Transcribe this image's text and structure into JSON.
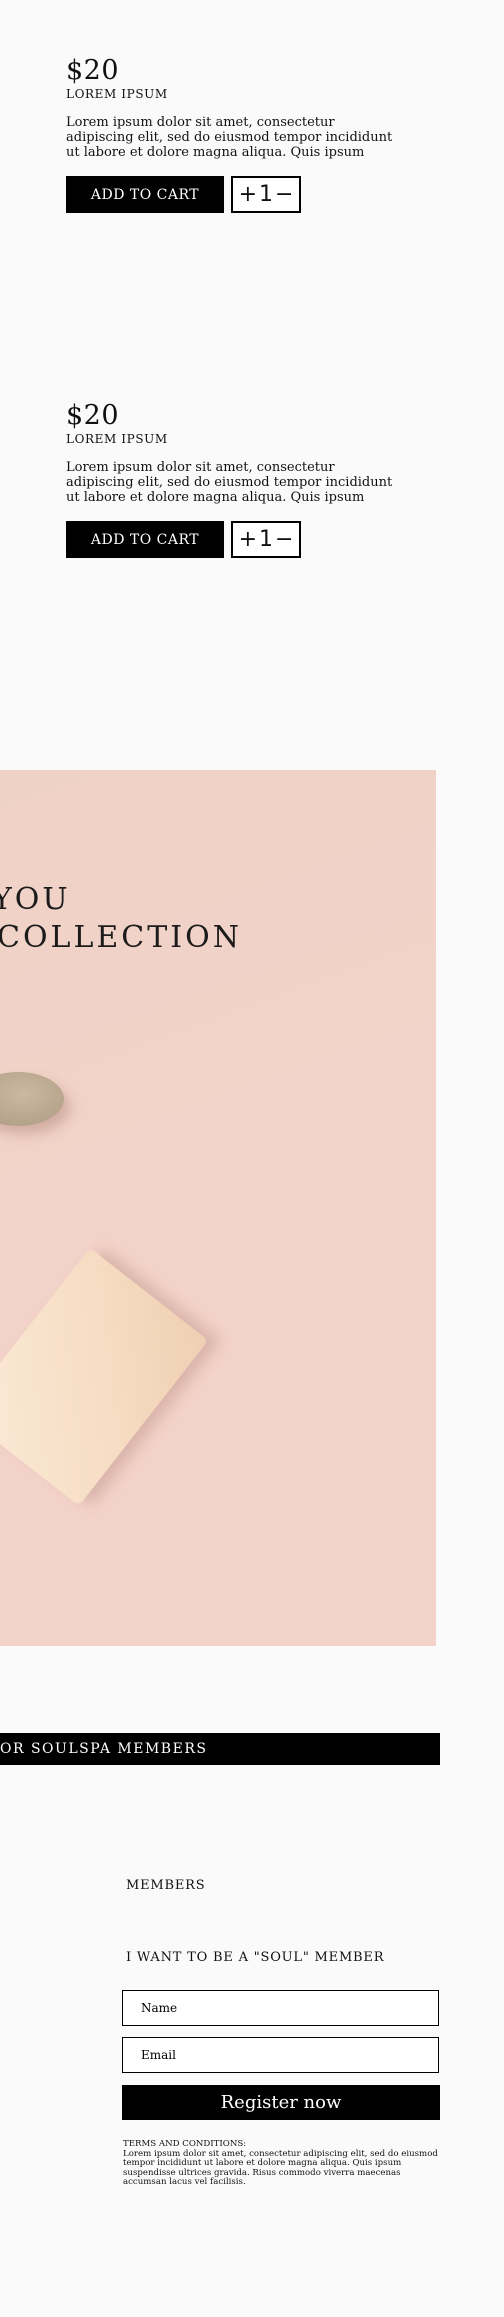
{
  "products": [
    {
      "price": "$20",
      "name": "LOREM IPSUM",
      "description": "Lorem ipsum dolor sit amet, consectetur adipiscing elit, sed do eiusmod tempor incididunt ut labore et dolore magna aliqua. Quis ipsum",
      "add_to_cart_label": "ADD TO CART",
      "stepper": {
        "plus": "+",
        "quantity": "1",
        "minus": "−"
      }
    },
    {
      "price": "$20",
      "name": "LOREM IPSUM",
      "description": "Lorem ipsum dolor sit amet, consectetur adipiscing elit, sed do eiusmod tempor incididunt ut labore et dolore magna aliqua. Quis ipsum",
      "add_to_cart_label": "ADD TO CART",
      "stepper": {
        "plus": "+",
        "quantity": "1",
        "minus": "−"
      }
    }
  ],
  "hero": {
    "line1": "YOU",
    "line2": "COLLECTION",
    "background_color": "#f3d3c9"
  },
  "members_banner": {
    "text": "OR SOULSPA MEMBERS"
  },
  "signup": {
    "section_label": "MEMBERS",
    "title": "I WANT TO BE A \"SOUL\" MEMBER",
    "name_placeholder": "Name",
    "email_placeholder": "Email",
    "register_label": "Register now",
    "terms_title": "TERMS AND CONDITIONS:",
    "terms_text": "Lorem ipsum dolor sit amet, consectetur adipiscing elit, sed do eiusmod tempor incididunt ut labore et dolore magna aliqua. Quis ipsum suspendisse ultrices gravida. Risus commodo viverra maecenas accumsan lacus vel facilisis."
  }
}
